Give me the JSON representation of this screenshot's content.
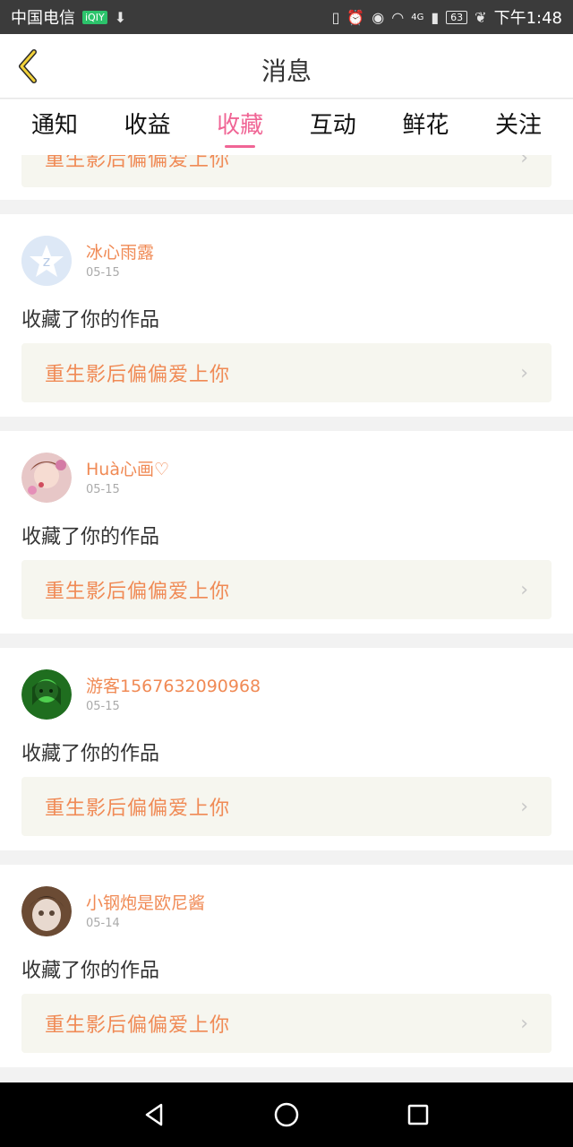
{
  "status_bar": {
    "carrier": "中国电信",
    "carrier_badge": "iQIY",
    "time": "下午1:48",
    "battery": "63",
    "network": "4G"
  },
  "header": {
    "title": "消息"
  },
  "tabs": [
    {
      "label": "通知"
    },
    {
      "label": "收益"
    },
    {
      "label": "收藏"
    },
    {
      "label": "互动"
    },
    {
      "label": "鲜花"
    },
    {
      "label": "关注"
    }
  ],
  "active_tab": "收藏",
  "top_partial_card": {
    "work_title": "重生影后偏偏爱上你"
  },
  "items": [
    {
      "username": "冰心雨露",
      "date": "05-15",
      "action": "收藏了你的作品",
      "work_title": "重生影后偏偏爱上你"
    },
    {
      "username": "Huà心画♡",
      "date": "05-15",
      "action": "收藏了你的作品",
      "work_title": "重生影后偏偏爱上你"
    },
    {
      "username": "游客1567632090968",
      "date": "05-15",
      "action": "收藏了你的作品",
      "work_title": "重生影后偏偏爱上你"
    },
    {
      "username": "小钢炮是欧尼酱",
      "date": "05-14",
      "action": "收藏了你的作品",
      "work_title": "重生影后偏偏爱上你"
    }
  ],
  "colors": {
    "accent": "#f06595",
    "work_text": "#f08a55",
    "work_bg": "#f6f6ef"
  }
}
